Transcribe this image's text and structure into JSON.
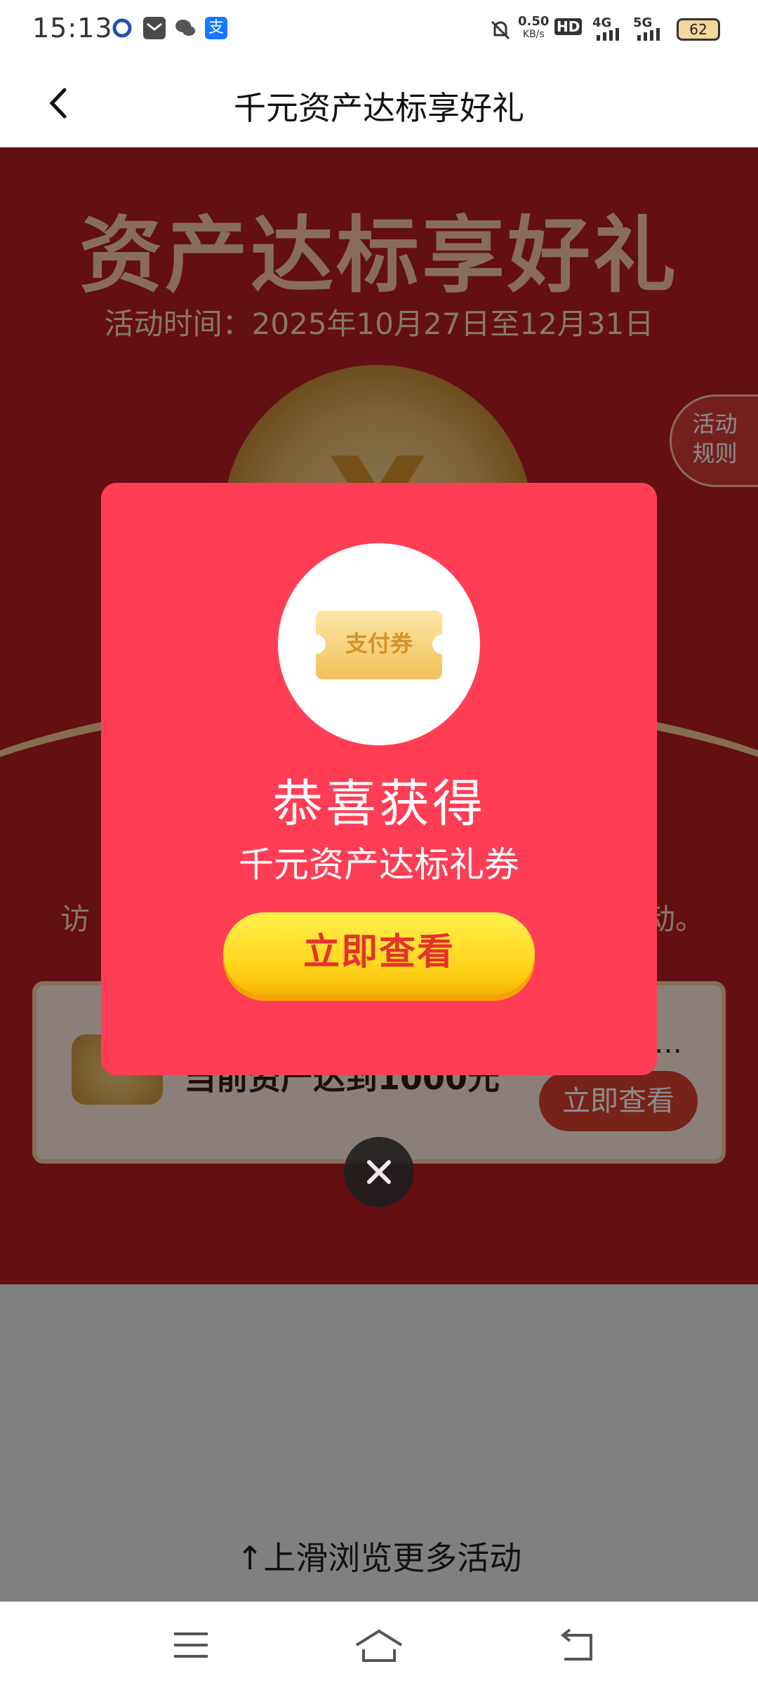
{
  "status_bar": {
    "time": "15:13",
    "network_speed": "0.50",
    "network_speed_unit": "KB/s",
    "hd_badge": "HD",
    "signal_1": "4G",
    "signal_2": "5G",
    "battery": "62",
    "notification_icons": [
      "baidu-icon",
      "mail-icon",
      "wechat-icon",
      "alipay-icon"
    ]
  },
  "header": {
    "title": "千元资产达标享好礼"
  },
  "page": {
    "hero_title": "资产达标享好礼",
    "date_text": "活动时间：2025年10月27日至12月31日",
    "rules_label_line1": "活动",
    "rules_label_line2": "规则",
    "visit_text": "访",
    "visit_suffix": "动。",
    "task": {
      "text": "当前资产达到1000元",
      "button": "立即查看",
      "dots": "…"
    },
    "swipe_hint": "↑上滑浏览更多活动"
  },
  "modal": {
    "ticket_label": "支付券",
    "congrats": "恭喜获得",
    "prize": "千元资产达标礼券",
    "cta": "立即查看"
  },
  "colors": {
    "modal_bg": "#ff3e56",
    "cta_yellow": "#ffd21a",
    "cta_text": "#e5322b",
    "page_red": "#b71d22"
  }
}
